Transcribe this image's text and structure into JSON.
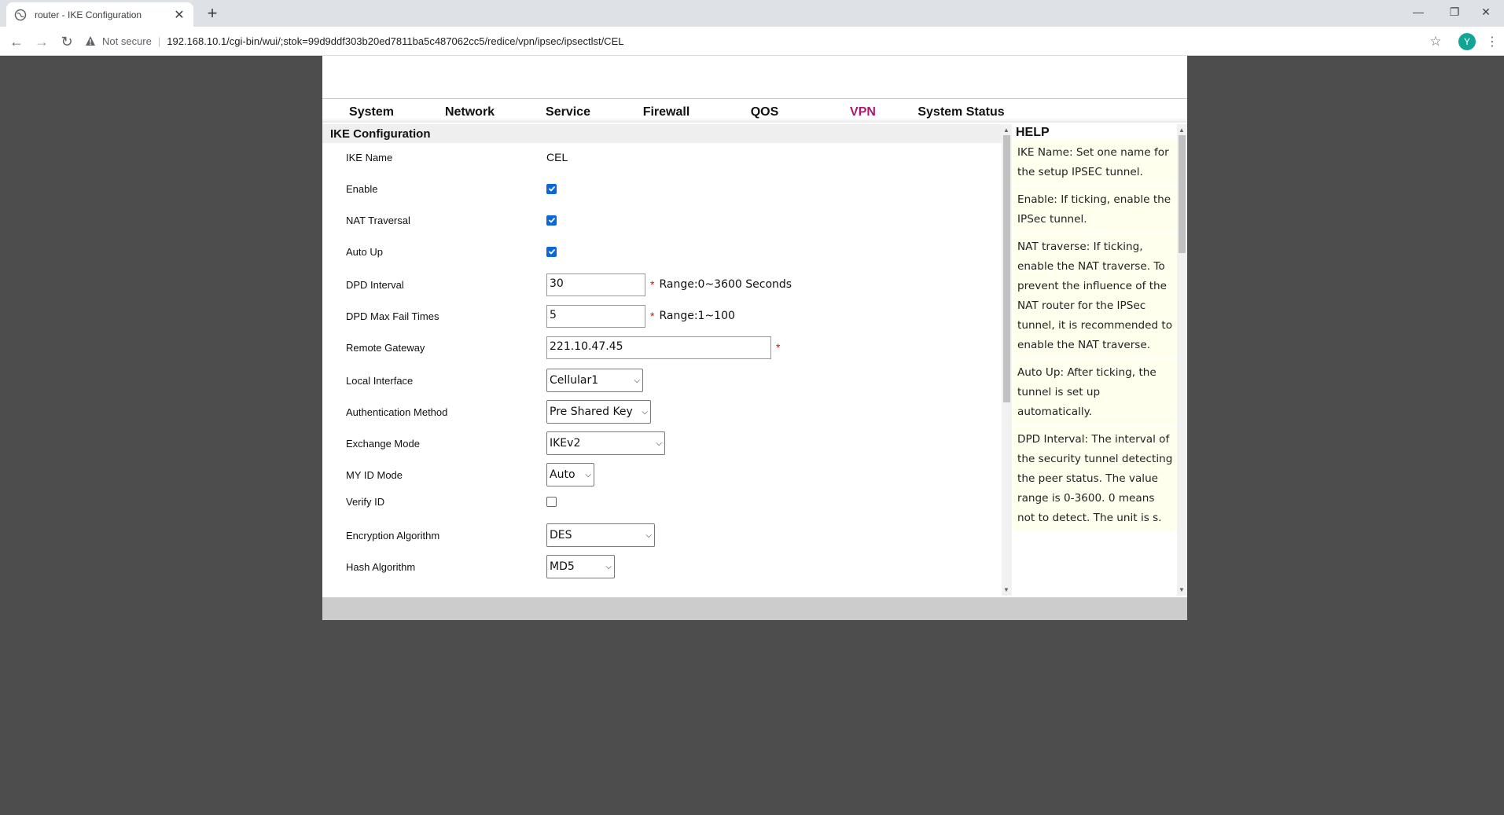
{
  "browser": {
    "tab_title": "router - IKE Configuration",
    "new_tab": "+",
    "not_secure": "Not secure",
    "url": "192.168.10.1/cgi-bin/wui/;stok=99d9ddf303b20ed7811ba5c487062cc5/redice/vpn/ipsec/ipsectlst/CEL",
    "profile_initial": "Y"
  },
  "menu": {
    "items": [
      "System",
      "Network",
      "Service",
      "Firewall",
      "QOS",
      "VPN",
      "System Status"
    ],
    "active": "VPN",
    "active_color": "#b0166f"
  },
  "form": {
    "title": "IKE Configuration",
    "ike_name": {
      "label": "IKE Name",
      "value": "CEL"
    },
    "enable": {
      "label": "Enable",
      "checked": true
    },
    "nat_traversal": {
      "label": "NAT Traversal",
      "checked": true
    },
    "auto_up": {
      "label": "Auto Up",
      "checked": true
    },
    "dpd_interval": {
      "label": "DPD Interval",
      "value": "30",
      "hint": "Range:0~3600 Seconds"
    },
    "dpd_max_fail": {
      "label": "DPD Max Fail Times",
      "value": "5",
      "hint": "Range:1~100"
    },
    "remote_gateway": {
      "label": "Remote Gateway",
      "value": "221.10.47.45"
    },
    "local_interface": {
      "label": "Local Interface",
      "value": "Cellular1"
    },
    "auth_method": {
      "label": "Authentication Method",
      "value": "Pre Shared Key"
    },
    "exchange_mode": {
      "label": "Exchange Mode",
      "value": "IKEv2"
    },
    "my_id_mode": {
      "label": "MY ID Mode",
      "value": "Auto"
    },
    "verify_id": {
      "label": "Verify ID",
      "checked": false
    },
    "encryption": {
      "label": "Encryption Algorithm",
      "value": "DES"
    },
    "hash": {
      "label": "Hash Algorithm",
      "value": "MD5"
    },
    "required_mark": "*"
  },
  "help": {
    "title": "HELP",
    "items": [
      "IKE Name: Set one name for the setup IPSEC tunnel.",
      "Enable: If ticking, enable the IPSec tunnel.",
      "NAT traverse: If ticking, enable the NAT traverse. To prevent the influence of the NAT router for the IPSec tunnel, it is recommended to enable the NAT traverse.",
      "Auto Up: After ticking, the tunnel is set up automatically.",
      "DPD Interval: The interval of the security tunnel detecting the peer status. The value range is 0-3600. 0 means not to detect. The unit is s."
    ]
  }
}
